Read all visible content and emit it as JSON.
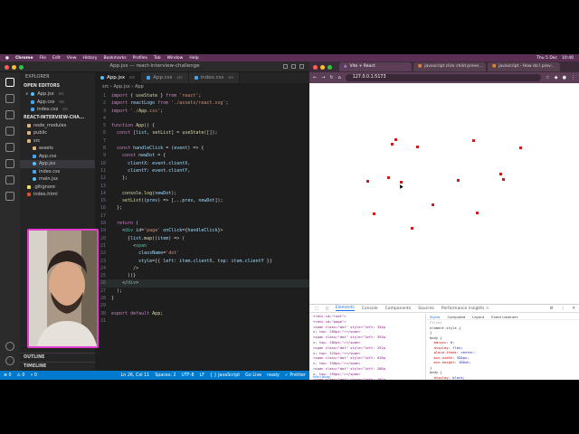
{
  "menubar": {
    "app": "Chrome",
    "items": [
      "File",
      "Edit",
      "View",
      "History",
      "Bookmarks",
      "Profiles",
      "Tab",
      "Window",
      "Help"
    ],
    "right": [
      "Thu 5 Dec",
      "10:46"
    ]
  },
  "vscode": {
    "title": "App.jsx — react-interview-challenge",
    "explorer_label": "EXPLORER",
    "open_editors_label": "OPEN EDITORS",
    "open_editors": [
      {
        "name": "App.jsx",
        "dir": "src",
        "icon": "react",
        "close": "✕"
      },
      {
        "name": "App.css",
        "dir": "src",
        "icon": "css"
      },
      {
        "name": "index.css",
        "dir": "src",
        "icon": "css"
      }
    ],
    "project_label": "REACT-INTERVIEW-CHA...",
    "tree": [
      {
        "name": "node_modules",
        "icon": "folder",
        "indent": 1
      },
      {
        "name": "public",
        "icon": "folder",
        "indent": 1
      },
      {
        "name": "src",
        "icon": "folder",
        "indent": 1
      },
      {
        "name": "assets",
        "icon": "folder",
        "indent": 2
      },
      {
        "name": "App.css",
        "icon": "css",
        "indent": 2
      },
      {
        "name": "App.jsx",
        "icon": "react",
        "indent": 2,
        "selected": true
      },
      {
        "name": "index.css",
        "icon": "css",
        "indent": 2
      },
      {
        "name": "main.jsx",
        "icon": "react",
        "indent": 2
      },
      {
        "name": ".gitignore",
        "icon": "js",
        "indent": 1
      },
      {
        "name": "index.html",
        "icon": "html",
        "indent": 1
      }
    ],
    "outline_label": "OUTLINE",
    "timeline_label": "TIMELINE",
    "tabs": [
      {
        "label": "App.jsx",
        "dir": "src",
        "active": true
      },
      {
        "label": "App.css",
        "dir": "src",
        "active": false
      },
      {
        "label": "index.css",
        "dir": "src",
        "active": false
      }
    ],
    "breadcrumb": "src › App.jsx › App",
    "code_lines": [
      "import { useState } from 'react';",
      "import reactLogo from './assets/react.svg';",
      "import './App.css';",
      "",
      "function App() {",
      "  const [list, setList] = useState([]);",
      "",
      "  const handleClick = (event) => {",
      "    const newDot = {",
      "      clientX: event.clientX,",
      "      clientY: event.clientY,",
      "    };",
      "",
      "    console.log(newDot);",
      "    setList((prev) => [...prev, newDot]);",
      "  };",
      "",
      "  return (",
      "    <div id='page' onClick={handleClick}>",
      "      {list.map((item) => (",
      "        <span",
      "          className='dot'",
      "          style={{ left: item.clientX, top: item.clientY }}",
      "        />",
      "      ))}",
      "    </div>",
      "  );",
      "}",
      "",
      "export default App;",
      ""
    ],
    "status": {
      "errors": "⊗ 0",
      "warnings": "⚠ 0",
      "ports": "⑂ 0",
      "position": "Ln 26, Col 11",
      "spaces": "Spaces: 2",
      "encoding": "UTF-8",
      "eol": "LF",
      "language": "{ } JavaScript",
      "golive": "Go Live",
      "ready": "ready",
      "prettier": "✓ Prettier"
    }
  },
  "chrome": {
    "tabs": [
      {
        "label": "Vite + React",
        "active": true
      },
      {
        "label": "javascript click child preve...",
        "active": false
      },
      {
        "label": "javascript - How do I prev...",
        "active": false
      }
    ],
    "url": "127.0.0.1:5173",
    "dots": [
      [
        0.317,
        0.25
      ],
      [
        0.303,
        0.272
      ],
      [
        0.396,
        0.283
      ],
      [
        0.604,
        0.254
      ],
      [
        0.779,
        0.286
      ],
      [
        0.211,
        0.439
      ],
      [
        0.289,
        0.421
      ],
      [
        0.336,
        0.443
      ],
      [
        0.547,
        0.435
      ],
      [
        0.715,
        0.432
      ],
      [
        0.704,
        0.407
      ],
      [
        0.235,
        0.585
      ],
      [
        0.453,
        0.544
      ],
      [
        0.617,
        0.582
      ],
      [
        0.376,
        0.651
      ]
    ]
  },
  "devtools": {
    "tabs": [
      "Elements",
      "Console",
      "Components",
      "Sources",
      "Performance insights ⚠"
    ],
    "elements": [
      "▾<div id=\"root\">",
      "  ▾<div id=\"page\">",
      "    <span class=\"dot\" style=\"left: 354p",
      "    x; top: 285px;\"></span>",
      "    <span class=\"dot\" style=\"left: 593p",
      "    x; top: 282px;\"></span>",
      "    <span class=\"dot\" style=\"left: 252p",
      "    x; top: 322px;\"></span>",
      "    <span class=\"dot\" style=\"left: 628p",
      "    x; top: 350px;\"></span>",
      "    <span class=\"dot\" style=\"left: 286p",
      "    x; top: 294px;\"></span>",
      "    <span class=\"dot\" style=\"left: 161p",
      "    x; top: 322px;\"></span>",
      "    <span class=\"dot\" style=\"left: 401p",
      "    x; top: 145px;\"></span>"
    ],
    "breadcrumb": "html  body",
    "style_tabs": [
      "Styles",
      "Computed",
      "Layout",
      "Event Listeners"
    ],
    "filter": "Filter",
    "styles": [
      "element.style {",
      "}",
      "body {",
      "  margin: 0;",
      "  display: flex;",
      "  place-items: center;",
      "  min-width: 320px;",
      "  min-height: 100vh;",
      "}",
      "body {",
      "  display: block;",
      "  margin: 8px;",
      "}",
      "Inherited from html",
      "@media (prefers-color-scheme: light)",
      ":root {"
    ]
  },
  "colors": {
    "vscode_bg": "#1e1e1e",
    "statusbar": "#007acc",
    "dot": "#d01c1c",
    "webcam_border": "#e23ecf"
  }
}
